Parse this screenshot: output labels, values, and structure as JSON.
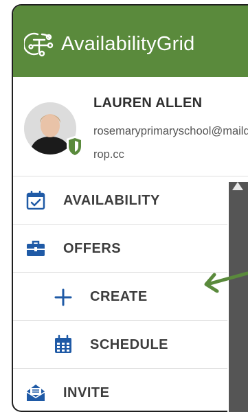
{
  "brand": {
    "name": "AvailabilityGrid",
    "color": "#5a8a3c"
  },
  "user": {
    "name": "LAUREN ALLEN",
    "email": "rosemaryprimaryschool@maildrop.cc",
    "badge_icon": "shield-icon"
  },
  "nav": {
    "items": [
      {
        "label": "AVAILABILITY",
        "icon": "calendar-check-icon"
      },
      {
        "label": "OFFERS",
        "icon": "briefcase-icon"
      },
      {
        "label": "CREATE",
        "icon": "plus-icon"
      },
      {
        "label": "SCHEDULE",
        "icon": "calendar-grid-icon"
      },
      {
        "label": "INVITE",
        "icon": "envelope-open-icon"
      }
    ]
  },
  "colors": {
    "icon_blue": "#1f5aa6",
    "arrow_green": "#5a8a3c",
    "scrollbar": "#555555"
  }
}
